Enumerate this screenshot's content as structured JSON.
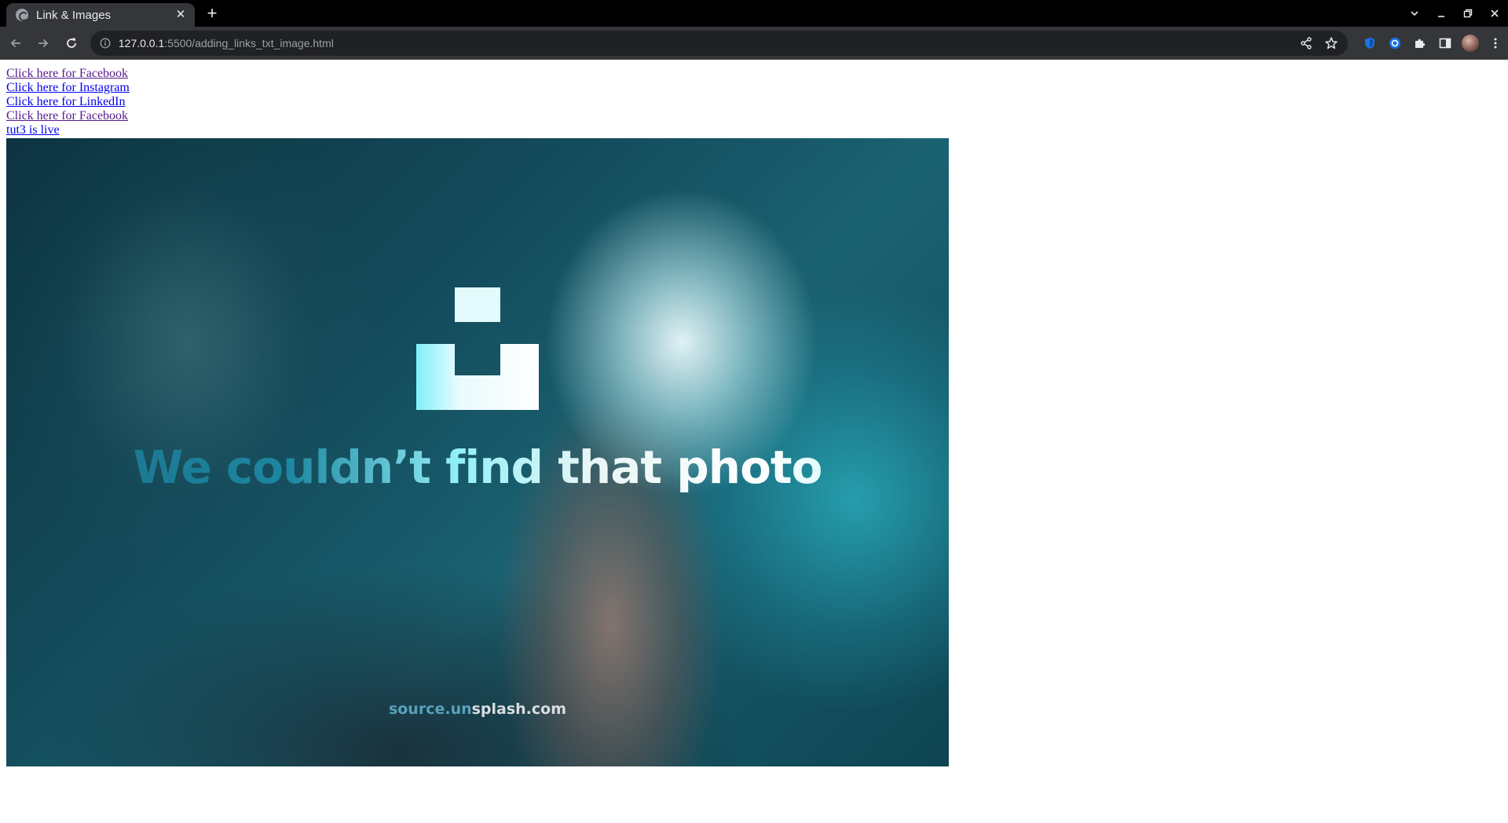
{
  "browser": {
    "tab_title": "Link & Images",
    "tab_close": "✕",
    "new_tab": "+",
    "url_host": "127.0.0.1",
    "url_rest": ":5500/adding_links_txt_image.html"
  },
  "page": {
    "links": [
      {
        "text": "Click here for Facebook",
        "visited": true
      },
      {
        "text": "Click here for Instagram",
        "visited": false
      },
      {
        "text": "Click here for LinkedIn",
        "visited": false
      },
      {
        "text": "Click here for Facebook",
        "visited": true
      },
      {
        "text": "tut3 is live",
        "visited": false
      }
    ],
    "image": {
      "headline": "We couldn’t find that photo",
      "source_part1": "source.un",
      "source_part2": "splash.com"
    }
  },
  "colors": {
    "tabbar_bg": "#000000",
    "toolbar_bg": "#35363a",
    "omnibox_bg": "#202124",
    "link": "#0000ee",
    "link_visited": "#551a8b"
  },
  "icons": {
    "back": "arrow-left-icon",
    "forward": "arrow-right-icon",
    "reload": "reload-icon",
    "share": "share-icon",
    "bookmark": "star-icon",
    "extensions": "puzzle-icon"
  }
}
